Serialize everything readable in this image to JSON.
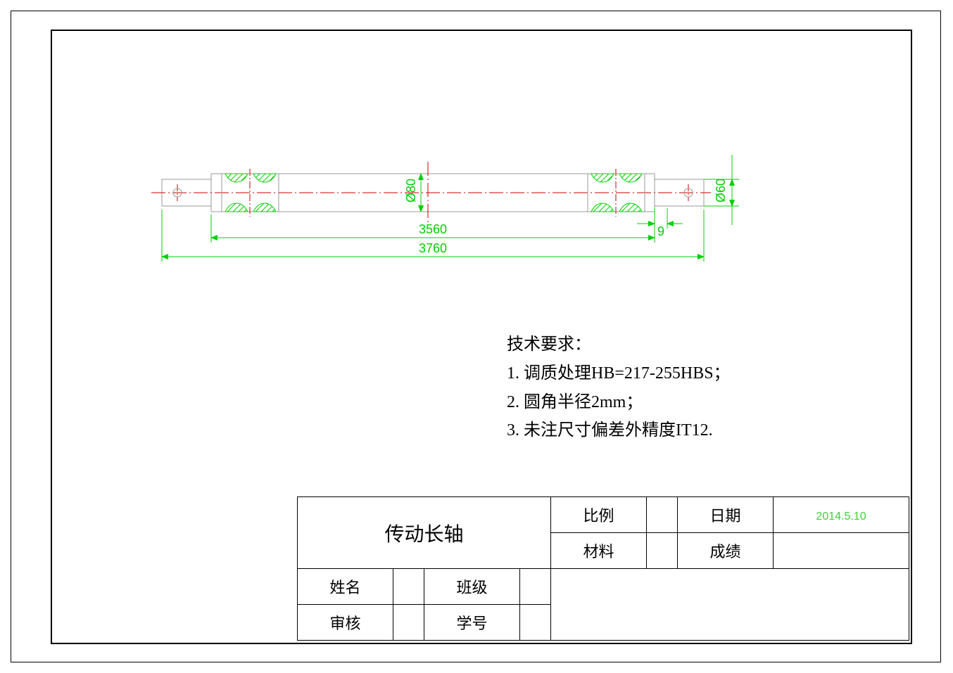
{
  "dimensions": {
    "d80": "Ø80",
    "d60": "Ø60",
    "len_inner": "3560",
    "len_outer": "3760",
    "gap": "9"
  },
  "notes": {
    "title": "技术要求：",
    "item1": "1. 调质处理HB=217-255HBS；",
    "item2": "2. 圆角半径2mm；",
    "item3": "3. 未注尺寸偏差外精度IT12."
  },
  "titleblock": {
    "title": "传动长轴",
    "scale_label": "比例",
    "scale_value": "",
    "date_label": "日期",
    "date_value": "2014.5.10",
    "material_label": "材料",
    "material_value": "",
    "grade_label": "成绩",
    "grade_value": "",
    "name_label": "姓名",
    "name_value": "",
    "class_label": "班级",
    "class_value": "",
    "review_label": "审核",
    "review_value": "",
    "id_label": "学号",
    "id_value": ""
  }
}
